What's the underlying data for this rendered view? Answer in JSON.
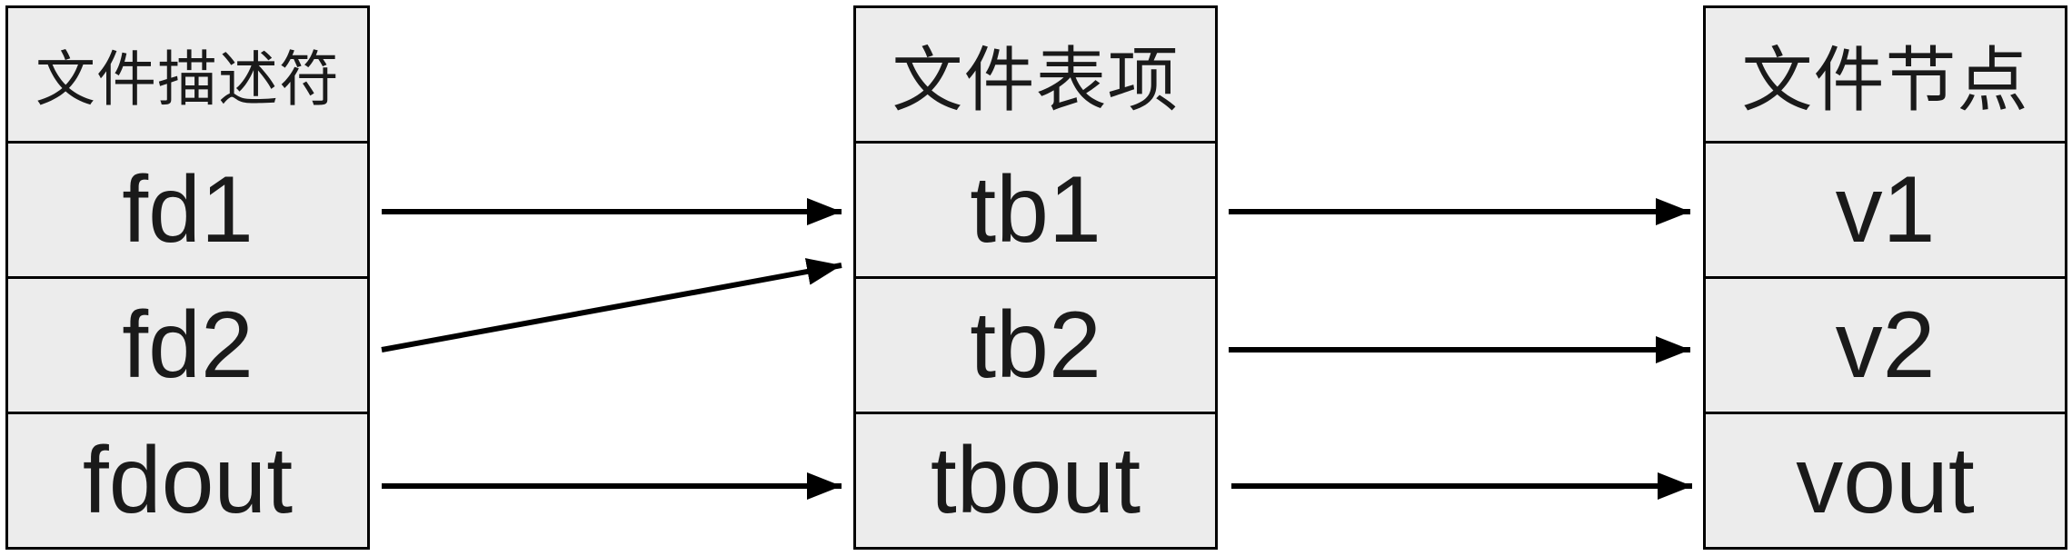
{
  "columns": [
    {
      "header": "文件描述符",
      "items": [
        "fd1",
        "fd2",
        "fdout"
      ]
    },
    {
      "header": "文件表项",
      "items": [
        "tb1",
        "tb2",
        "tbout"
      ]
    },
    {
      "header": "文件节点",
      "items": [
        "v1",
        "v2",
        "vout"
      ]
    }
  ],
  "colors": {
    "cell_fill": "#ececec",
    "border": "#000000",
    "arrow": "#000000",
    "text": "#1a1a1a"
  }
}
